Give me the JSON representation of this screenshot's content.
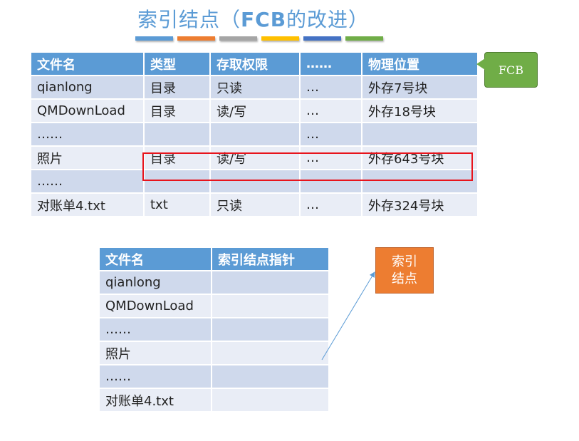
{
  "title": {
    "main": "索引结点（",
    "bold": "FCB",
    "rest": "的改进）"
  },
  "accent_bars": [
    "#5b9bd5",
    "#ed7d31",
    "#a5a5a5",
    "#ffc000",
    "#4472c4",
    "#70ad47"
  ],
  "fcb_table": {
    "headers": [
      "文件名",
      "类型",
      "存取权限",
      "……",
      "物理位置"
    ],
    "rows": [
      [
        "qianlong",
        "目录",
        "只读",
        "…",
        "外存7号块"
      ],
      [
        "QMDownLoad",
        "目录",
        "读/写",
        "…",
        "外存18号块"
      ],
      [
        "……",
        "",
        "",
        "…",
        ""
      ],
      [
        "照片",
        "目录",
        "读/写",
        "…",
        "外存643号块"
      ],
      [
        "……",
        "",
        "",
        "",
        ""
      ],
      [
        "对账单4.txt",
        "txt",
        "只读",
        "…",
        "外存324号块"
      ]
    ]
  },
  "fcb_callout": "FCB",
  "dir_table": {
    "headers": [
      "文件名",
      "索引结点指针"
    ],
    "rows": [
      [
        "qianlong",
        ""
      ],
      [
        "QMDownLoad",
        ""
      ],
      [
        "……",
        ""
      ],
      [
        "照片",
        ""
      ],
      [
        "……",
        ""
      ],
      [
        "对账单4.txt",
        ""
      ]
    ]
  },
  "index_node_box": "索引结点"
}
